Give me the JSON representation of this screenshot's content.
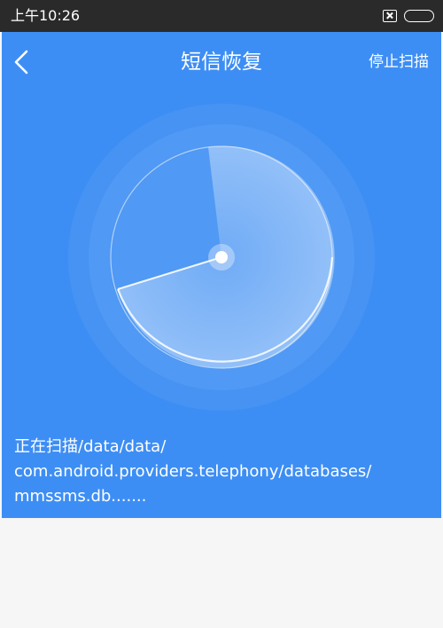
{
  "status_bar": {
    "time": "上午10:26",
    "notification_icon": "notification-x-icon",
    "battery_icon": "battery-icon"
  },
  "app_bar": {
    "back_icon": "back-chevron-icon",
    "title": "短信恢复",
    "stop_label": "停止扫描"
  },
  "scan": {
    "line1": "正在扫描/data/data/",
    "line2": "com.android.providers.telephony/databases/",
    "line3": "mmssms.db......."
  },
  "colors": {
    "status_bar_bg": "#2a2a2a",
    "primary_blue": "#3d8ef4",
    "content_bg": "#f6f6f6",
    "text_white": "#ffffff"
  }
}
